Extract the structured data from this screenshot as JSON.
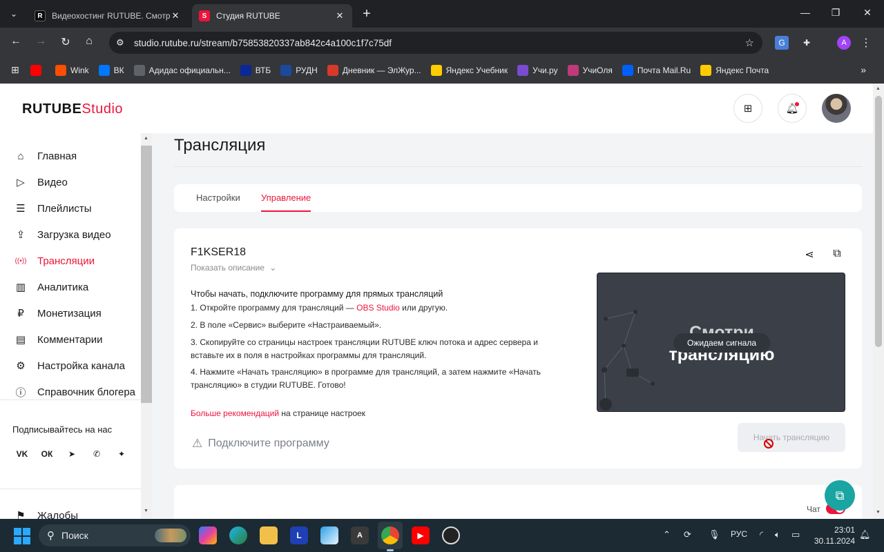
{
  "browser": {
    "tabs": [
      {
        "title": "Видеохостинг RUTUBE. Смотрите",
        "favicon": "R",
        "color": "#0d0d0d"
      },
      {
        "title": "Студия RUTUBE",
        "favicon": "S",
        "color": "#ed143b"
      }
    ],
    "url": "studio.rutube.ru/stream/b75853820337ab842c4a100c1f7c75df",
    "profile_initial": "A"
  },
  "bookmarks": [
    {
      "label": "",
      "icon": "youtube-icon",
      "color": "#ff0000"
    },
    {
      "label": "Wink",
      "icon": "wink-icon",
      "color": "#ff4e00"
    },
    {
      "label": "ВК",
      "icon": "vk-icon",
      "color": "#0077ff"
    },
    {
      "label": "Адидас официальн...",
      "icon": "adidas-icon",
      "color": "#5f6368"
    },
    {
      "label": "ВТБ",
      "icon": "vtb-icon",
      "color": "#0a2896"
    },
    {
      "label": "РУДН",
      "icon": "rudn-icon",
      "color": "#1b4a9c"
    },
    {
      "label": "Дневник — ЭлЖур...",
      "icon": "eljur-icon",
      "color": "#d83a2a"
    },
    {
      "label": "Яндекс Учебник",
      "icon": "yandex-textbook-icon",
      "color": "#ffcc00"
    },
    {
      "label": "Учи.ру",
      "icon": "uchi-icon",
      "color": "#7a4bd0"
    },
    {
      "label": "УчиОля",
      "icon": "uchiolya-icon",
      "color": "#c0397a"
    },
    {
      "label": "Почта Mail.Ru",
      "icon": "mailru-icon",
      "color": "#005ff9"
    },
    {
      "label": "Яндекс Почта",
      "icon": "yandex-mail-icon",
      "color": "#ffcc00"
    }
  ],
  "header": {
    "logo_main": "RUTUBE",
    "logo_sub": "Studio"
  },
  "sidebar": {
    "items": [
      {
        "label": "Главная",
        "icon": "home-icon",
        "active": false
      },
      {
        "label": "Видео",
        "icon": "video-icon",
        "active": false
      },
      {
        "label": "Плейлисты",
        "icon": "playlist-icon",
        "active": false
      },
      {
        "label": "Загрузка видео",
        "icon": "upload-icon",
        "active": false
      },
      {
        "label": "Трансляции",
        "icon": "broadcast-icon",
        "active": true
      },
      {
        "label": "Аналитика",
        "icon": "analytics-icon",
        "active": false
      },
      {
        "label": "Монетизация",
        "icon": "ruble-icon",
        "active": false
      },
      {
        "label": "Комментарии",
        "icon": "comment-icon",
        "active": false
      },
      {
        "label": "Настройка канала",
        "icon": "gear-icon",
        "active": false
      },
      {
        "label": "Справочник блогера",
        "icon": "info-icon",
        "active": false
      }
    ],
    "follow_label": "Подписывайтесь на нас",
    "socials": [
      "vk-icon",
      "ok-icon",
      "telegram-icon",
      "viber-icon",
      "dzen-icon"
    ],
    "bottom_item": "Жалобы"
  },
  "main": {
    "title": "Трансляция",
    "tabs": [
      "Настройки",
      "Управление"
    ],
    "active_tab": "Управление",
    "stream": {
      "name": "F1KSER18",
      "show_description": "Показать описание",
      "instructions_title": "Чтобы начать, подключите программу для прямых трансляций",
      "step1_prefix": "1. Откройте программу для трансляций — ",
      "step1_link": "OBS Studio",
      "step1_suffix": " или другую.",
      "step2": "2. В поле «Сервис» выберите «Настраиваемый».",
      "step3": "3. Скопируйте со страницы настроек трансляции RUTUBE ключ потока и адрес сервера и вставьте их в поля в настройках программы для трансляций.",
      "step4": "4. Нажмите «Начать трансляцию» в программе для трансляций, а затем нажмите «Начать трансляцию» в студии RUTUBE. Готово!",
      "more_link": "Больше рекомендаций",
      "more_suffix": " на странице настроек",
      "connect_status": "Подключите программу",
      "preview_big_line1": "Смотри",
      "preview_big_line2": "трансляцию",
      "preview_status": "Ожидаем сигнала",
      "start_button": "Начать трансляцию"
    },
    "chat_label": "Чат",
    "chat_enabled": true
  },
  "taskbar": {
    "search_label": "Поиск",
    "language": "РУС",
    "time": "23:01",
    "date": "30.11.2024"
  },
  "colors": {
    "accent": "#ed143b",
    "support": "#1aa5a2"
  }
}
